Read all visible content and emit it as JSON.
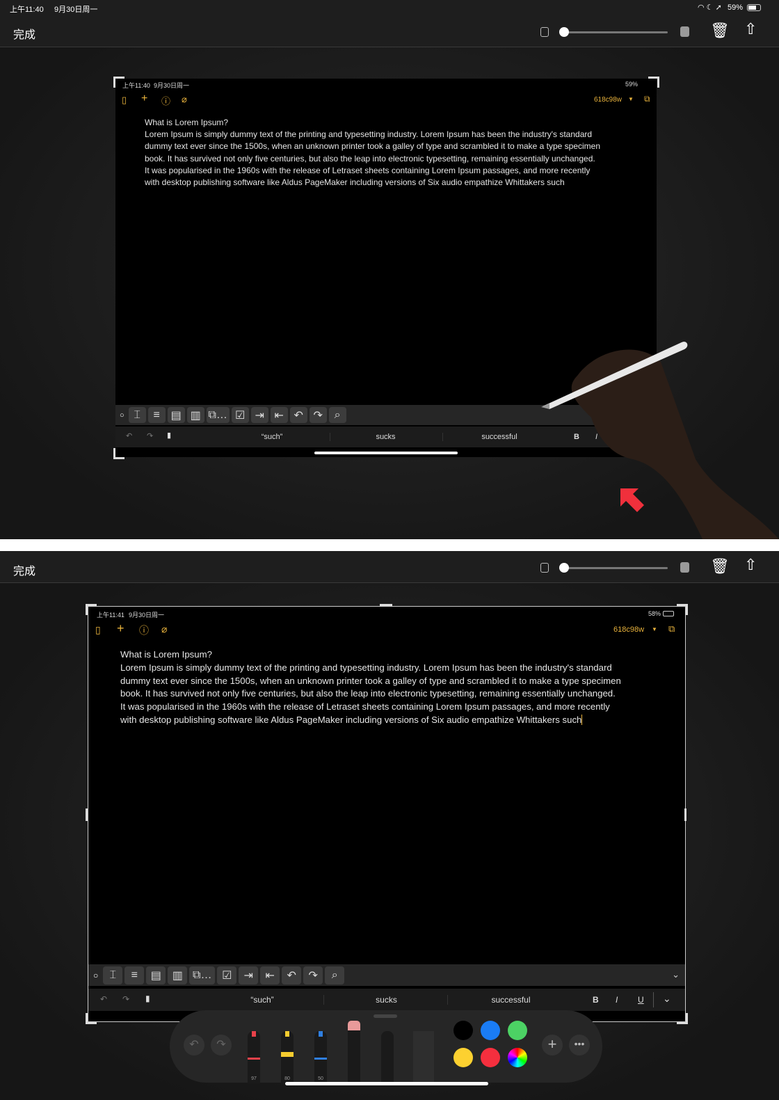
{
  "top": {
    "status": {
      "time": "上午11:40",
      "date": "9月30日周一",
      "battery": "59%"
    },
    "done_label": "完成",
    "inner": {
      "status": {
        "time": "上午11:40",
        "date": "9月30日周一",
        "battery": "59%"
      },
      "doc_name": "618c98w",
      "lines": [
        "What is Lorem Ipsum?",
        "Lorem Ipsum is simply dummy text of the printing and typesetting industry. Lorem Ipsum has been the industry's standard",
        "dummy text ever since the 1500s, when an unknown printer took a galley of type and scrambled it to make a type specimen",
        "book. It has survived not only five centuries, but also the leap into electronic typesetting, remaining essentially unchanged.",
        "It was popularised in the 1960s with the release of Letraset sheets containing Lorem Ipsum passages, and more recently",
        "with desktop publishing software like Aldus PageMaker including versions of Six audio empathize Whittakers such"
      ],
      "suggestions": [
        "“such”",
        "sucks",
        "successful"
      ],
      "bold": "B",
      "italic": "I"
    }
  },
  "bottom": {
    "done_label": "完成",
    "inner": {
      "status": {
        "time": "上午11:41",
        "date": "9月30日周一",
        "battery": "58%"
      },
      "doc_name": "618c98w",
      "lines": [
        "What is Lorem Ipsum?",
        "Lorem Ipsum is simply dummy text of the printing and typesetting industry. Lorem Ipsum has been the industry's standard",
        "dummy text ever since the 1500s, when an unknown printer took a galley of type and scrambled it to make a type specimen",
        "book. It has survived not only five centuries, but also the leap into electronic typesetting, remaining essentially unchanged.",
        "It was popularised in the 1960s with the release of Letraset sheets containing Lorem Ipsum passages, and more recently",
        "with desktop publishing software like Aldus PageMaker including versions of Six audio empathize Whittakers such"
      ],
      "suggestions": [
        "“such”",
        "sucks",
        "successful"
      ],
      "bold": "B",
      "italic": "I",
      "underline": "U"
    },
    "palette": {
      "tools": [
        {
          "name": "pen",
          "color": "#e8414a",
          "value": "97"
        },
        {
          "name": "marker",
          "color": "#f5cc2f",
          "value": "80"
        },
        {
          "name": "pencil",
          "color": "#2f7fe0",
          "value": "50"
        },
        {
          "name": "eraser",
          "color": "#e89a9a"
        },
        {
          "name": "lasso"
        },
        {
          "name": "ruler"
        }
      ],
      "colors": [
        "#000000",
        "#1a7cf5",
        "#4cd264",
        "#fdd130",
        "#f52f3e",
        "rainbow"
      ]
    }
  },
  "colors": {
    "accent": "#e8b23c",
    "annotation_arrow": "#f0303c"
  }
}
